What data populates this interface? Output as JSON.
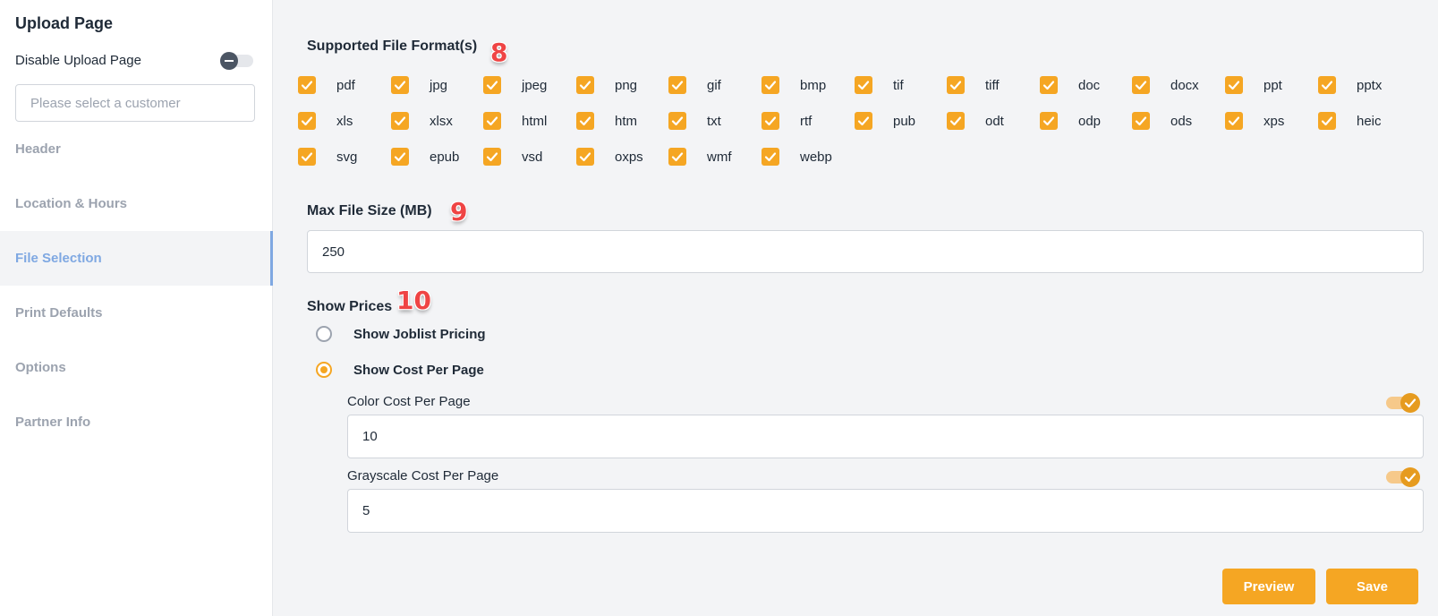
{
  "sidebar": {
    "title": "Upload Page",
    "disable_label": "Disable Upload Page",
    "customer_placeholder": "Please select a customer",
    "items": [
      {
        "label": "Header"
      },
      {
        "label": "Location & Hours"
      },
      {
        "label": "File Selection"
      },
      {
        "label": "Print Defaults"
      },
      {
        "label": "Options"
      },
      {
        "label": "Partner Info"
      }
    ]
  },
  "formats": {
    "title": "Supported File Format(s)",
    "badge": "8",
    "items": [
      "pdf",
      "jpg",
      "jpeg",
      "png",
      "gif",
      "bmp",
      "tif",
      "tiff",
      "doc",
      "docx",
      "ppt",
      "pptx",
      "xls",
      "xlsx",
      "html",
      "htm",
      "txt",
      "rtf",
      "pub",
      "odt",
      "odp",
      "ods",
      "xps",
      "heic",
      "svg",
      "epub",
      "vsd",
      "oxps",
      "wmf",
      "webp"
    ]
  },
  "max_size": {
    "title": "Max File Size (MB)",
    "badge": "9",
    "value": "250"
  },
  "prices": {
    "title": "Show Prices",
    "badge": "10",
    "option_joblist": "Show Joblist Pricing",
    "option_cost_per_page": "Show Cost Per Page",
    "selected": "Show Cost Per Page",
    "color_label": "Color Cost Per Page",
    "color_value": "10",
    "grayscale_label": "Grayscale Cost Per Page",
    "grayscale_value": "5"
  },
  "actions": {
    "preview": "Preview",
    "save": "Save"
  },
  "colors": {
    "accent": "#f5a623",
    "active_nav": "#7fa8e2",
    "badge": "#ef4444"
  }
}
